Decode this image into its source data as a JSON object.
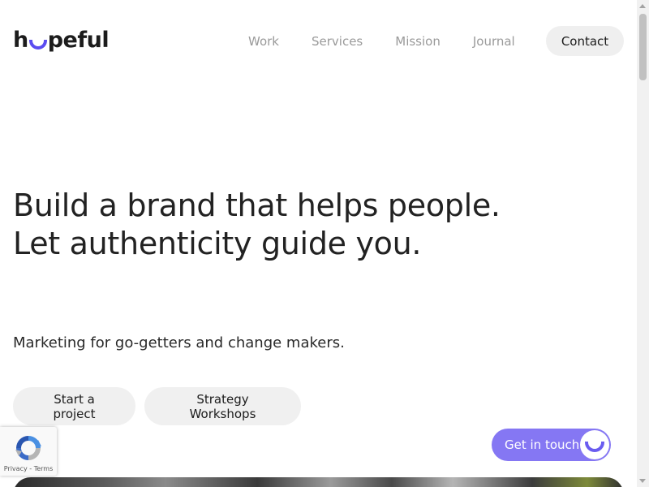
{
  "header": {
    "logo_text_before": "h",
    "logo_text_after": "peful",
    "nav": [
      "Work",
      "Services",
      "Mission",
      "Journal"
    ],
    "contact_label": "Contact"
  },
  "hero": {
    "title": "Build a brand that helps people. Let authenticity guide you.",
    "subtitle": "Marketing for go-getters and change makers.",
    "buttons": [
      "Start a project",
      "Strategy Workshops"
    ]
  },
  "floating": {
    "label": "Get in touch",
    "icon": "smile-icon"
  },
  "recaptcha": {
    "privacy": "Privacy",
    "separator": " - ",
    "terms": "Terms"
  },
  "colors": {
    "accent": "#8577f3",
    "logo_accent": "#5b4cf0",
    "nav_text": "#9a9a9a",
    "pill_bg": "#f0f0f0"
  }
}
